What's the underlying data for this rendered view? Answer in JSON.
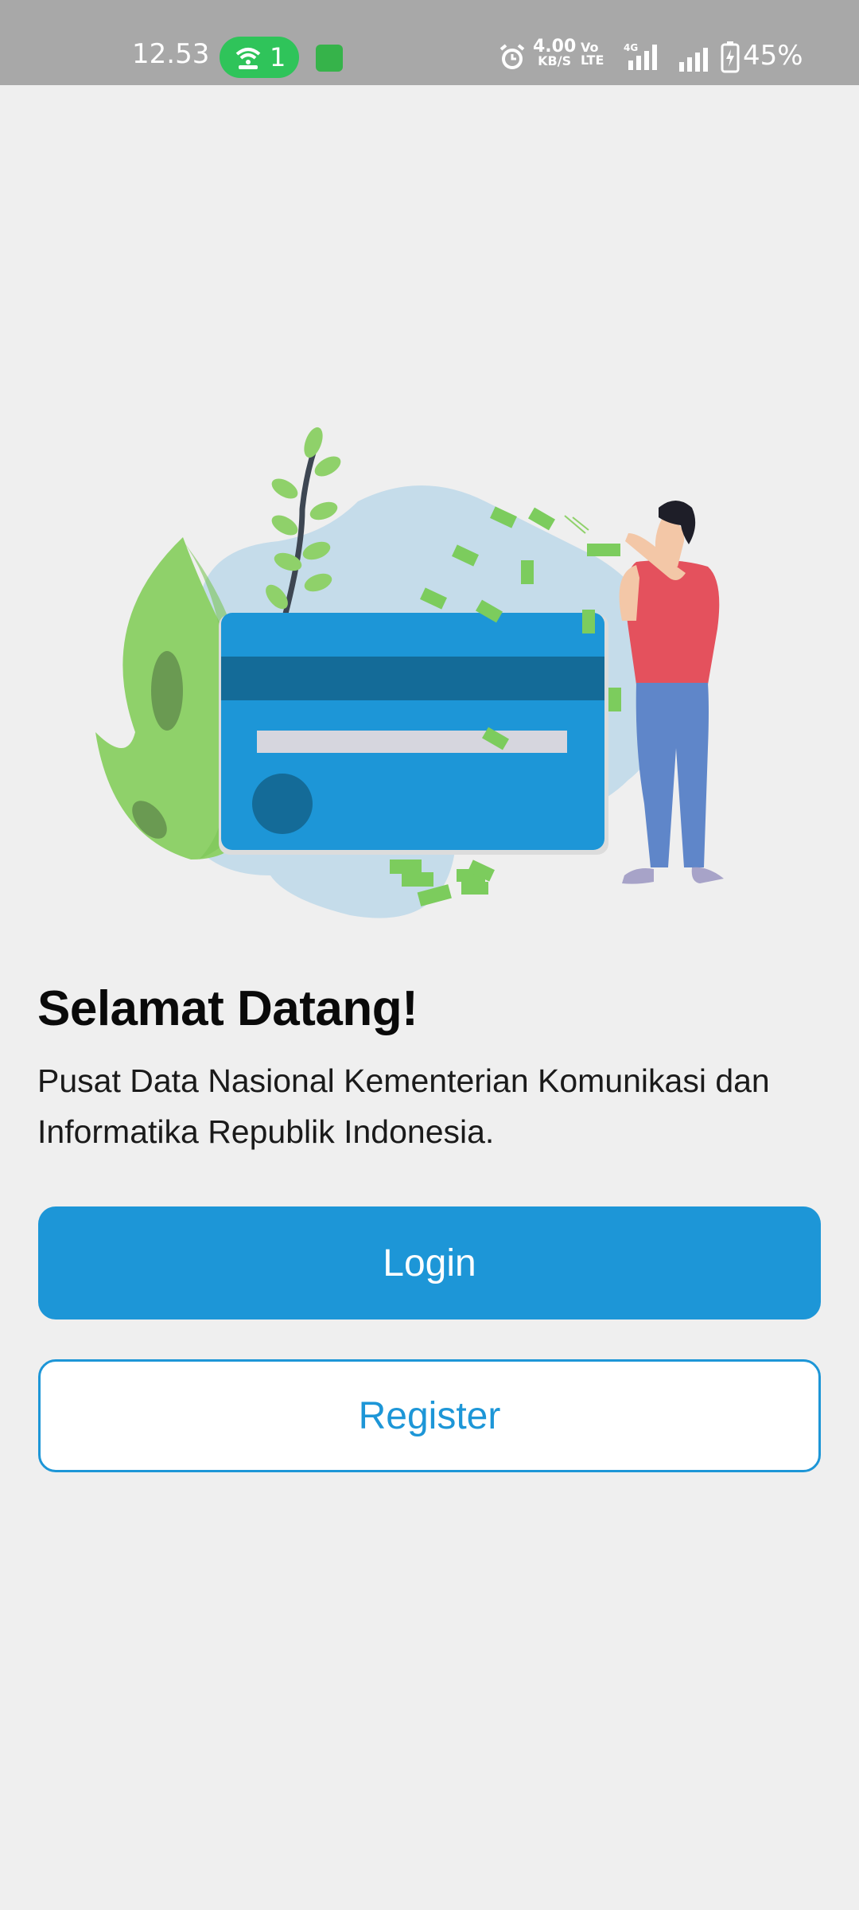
{
  "status_bar": {
    "time": "12.53",
    "wifi_count": "1",
    "speed_value": "4.00",
    "speed_unit": "KB/S",
    "volte_top": "Vo",
    "volte_bottom": "LTE",
    "network_type": "4G",
    "battery_percent": "45%",
    "icons": [
      "wifi-hotspot-icon",
      "app-notification-icon",
      "alarm-icon",
      "signal-icon",
      "battery-charging-icon"
    ]
  },
  "welcome": {
    "title": "Selamat Datang!",
    "description": "Pusat Data Nasional Kementerian Komunikasi dan Informatika Republik Indonesia."
  },
  "actions": {
    "login_label": "Login",
    "register_label": "Register"
  },
  "colors": {
    "primary": "#1d96d7",
    "background": "#efefef",
    "status_bar": "#a8a8a8"
  }
}
